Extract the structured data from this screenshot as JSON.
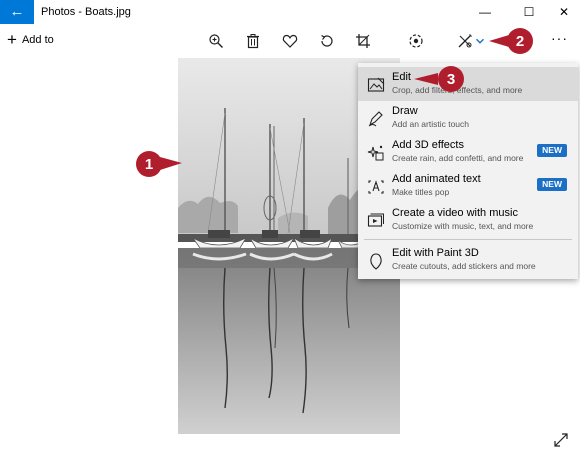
{
  "titlebar": {
    "title": "Photos - Boats.jpg",
    "back_icon": "←",
    "minimize": "—",
    "maximize": "☐",
    "close": "✕"
  },
  "toolbar": {
    "add_to_icon": "+",
    "add_to_label": "Add to",
    "more_label": "···"
  },
  "menu": {
    "items": [
      {
        "title": "Edit",
        "subtitle": "Crop, add filters, effects, and more",
        "icon": "edit-image-icon"
      },
      {
        "title": "Draw",
        "subtitle": "Add an artistic touch",
        "icon": "pen-icon"
      },
      {
        "title": "Add 3D effects",
        "subtitle": "Create rain, add confetti, and more",
        "badge": "NEW",
        "icon": "sparkle-icon"
      },
      {
        "title": "Add animated text",
        "subtitle": "Make titles pop",
        "badge": "NEW",
        "icon": "text-box-icon"
      },
      {
        "title": "Create a video with music",
        "subtitle": "Customize with music, text, and more",
        "icon": "video-icon"
      },
      {
        "title": "Edit with Paint 3D",
        "subtitle": "Create cutouts, add stickers and more",
        "icon": "paint3d-icon"
      }
    ]
  },
  "callouts": {
    "c1": "1",
    "c2": "2",
    "c3": "3"
  },
  "colors": {
    "accent": "#0078d7",
    "callout": "#b01e2e",
    "badge": "#1b6fc5"
  }
}
